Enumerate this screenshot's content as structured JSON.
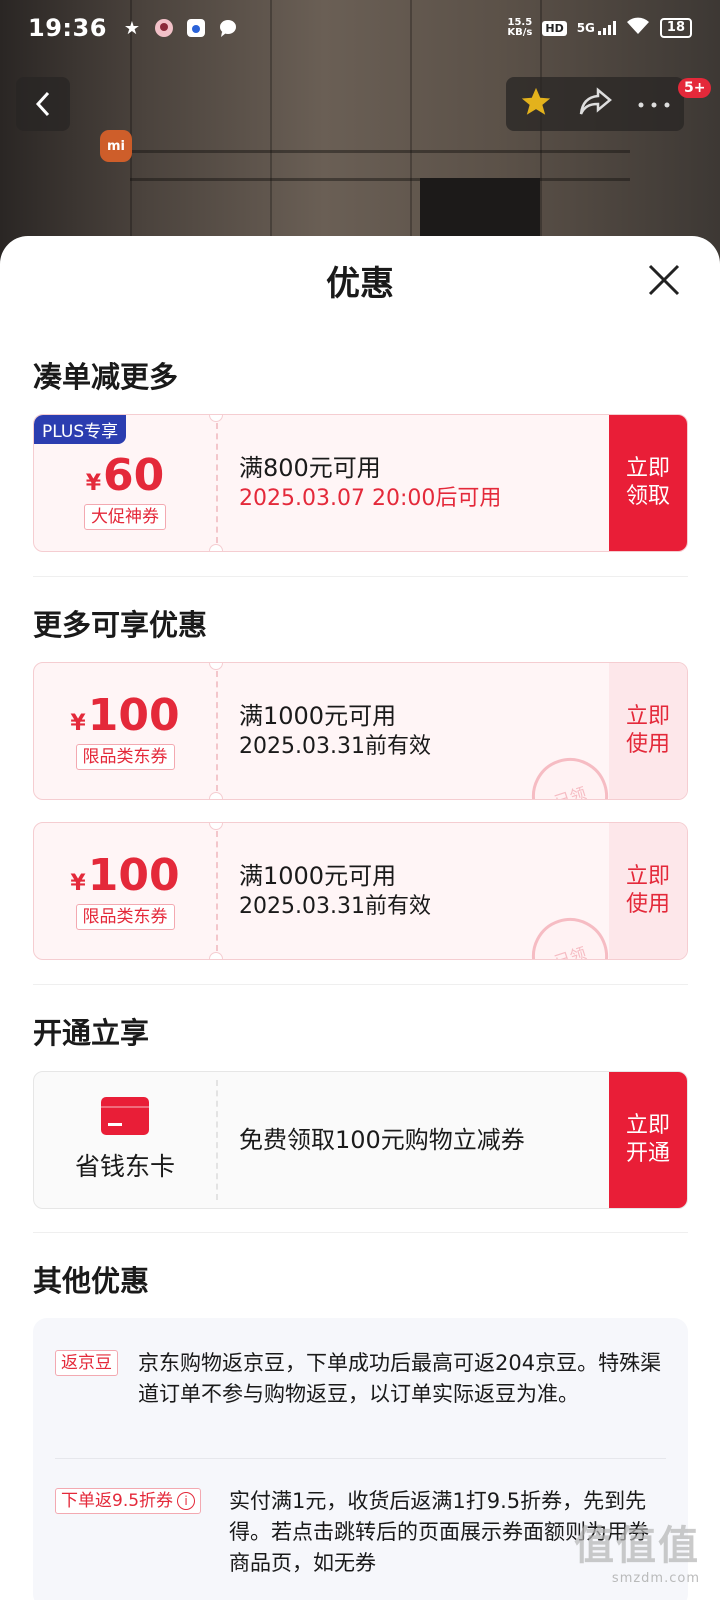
{
  "status_bar": {
    "time": "19:36",
    "net_speed_value": "15.5",
    "net_speed_unit": "KB/s",
    "hd": "HD",
    "network": "5G",
    "battery": "18"
  },
  "nav": {
    "badge": "5+",
    "brand_logo": "mi"
  },
  "sheet": {
    "title": "优惠"
  },
  "section_bundle": {
    "title": "凑单减更多",
    "coupon": {
      "plus_tag": "PLUS专享",
      "currency": "¥",
      "amount": "60",
      "tag": "大促神券",
      "condition": "满800元可用",
      "time": "2025.03.07 20:00后可用",
      "action": "立即领取"
    }
  },
  "section_more": {
    "title": "更多可享优惠",
    "coupons": [
      {
        "currency": "¥",
        "amount": "100",
        "tag": "限品类东券",
        "condition": "满1000元可用",
        "validity": "2025.03.31前有效",
        "action": "立即使用",
        "stamp": "已领"
      },
      {
        "currency": "¥",
        "amount": "100",
        "tag": "限品类东券",
        "condition": "满1000元可用",
        "validity": "2025.03.31前有效",
        "action": "立即使用",
        "stamp": "已领"
      }
    ]
  },
  "section_open": {
    "title": "开通立享",
    "card_name": "省钱东卡",
    "desc": "免费领取100元购物立减券",
    "action": "立即开通"
  },
  "section_other": {
    "title": "其他优惠",
    "items": [
      {
        "tag": "返京豆",
        "text": "京东购物返京豆，下单成功后最高可返204京豆。特殊渠道订单不参与购物返豆，以订单实际返豆为准。"
      },
      {
        "tag": "下单返9.5折券",
        "text": "实付满1元，收货后返满1打9.5折券，先到先得。若点击跳转后的页面展示券面额则为用券商品页，如无券"
      }
    ]
  },
  "watermark": {
    "main": "值值值",
    "sub": "smzdm.com"
  },
  "colors": {
    "accent": "#e91e37",
    "plus": "#2b3db0"
  }
}
